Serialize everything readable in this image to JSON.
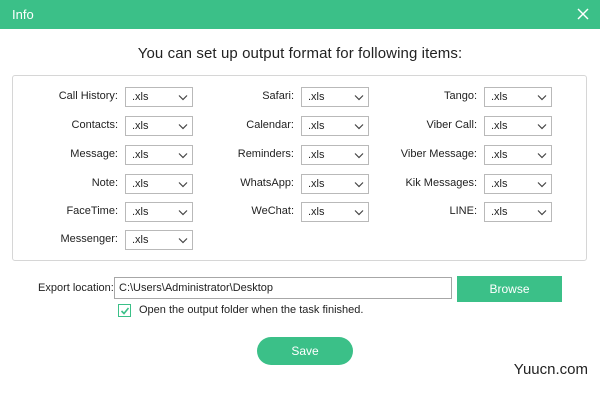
{
  "window": {
    "title": "Info",
    "accent_color": "#3bc088",
    "close_icon": "close-icon"
  },
  "heading": "You can set up output format for following items:",
  "format_items": [
    {
      "label": "Call History:",
      "value": ".xls"
    },
    {
      "label": "Contacts:",
      "value": ".xls"
    },
    {
      "label": "Message:",
      "value": ".xls"
    },
    {
      "label": "Note:",
      "value": ".xls"
    },
    {
      "label": "FaceTime:",
      "value": ".xls"
    },
    {
      "label": "Messenger:",
      "value": ".xls"
    },
    {
      "label": "Safari:",
      "value": ".xls"
    },
    {
      "label": "Calendar:",
      "value": ".xls"
    },
    {
      "label": "Reminders:",
      "value": ".xls"
    },
    {
      "label": "WhatsApp:",
      "value": ".xls"
    },
    {
      "label": "WeChat:",
      "value": ".xls"
    },
    {
      "label": "Tango:",
      "value": ".xls"
    },
    {
      "label": "Viber Call:",
      "value": ".xls"
    },
    {
      "label": "Viber Message:",
      "value": ".xls"
    },
    {
      "label": "Kik Messages:",
      "value": ".xls"
    },
    {
      "label": "LINE:",
      "value": ".xls"
    }
  ],
  "export": {
    "label": "Export location:",
    "path": "C:\\Users\\Administrator\\Desktop",
    "browse_label": "Browse"
  },
  "open_folder": {
    "checked": true,
    "label": "Open the output folder when the task finished."
  },
  "save_label": "Save",
  "watermark": "Yuucn.com"
}
